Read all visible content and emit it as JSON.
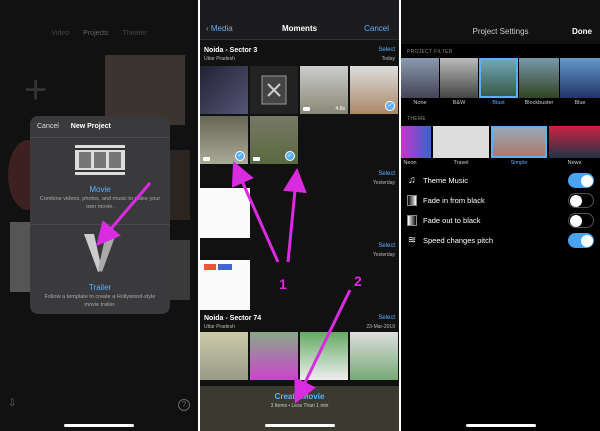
{
  "panel1": {
    "tabs": [
      "Video",
      "Projects",
      "Theater"
    ],
    "dialog": {
      "cancel": "Cancel",
      "title": "New Project",
      "movie": {
        "name": "Movie",
        "desc": "Combine videos, photos, and music to make your own movie."
      },
      "trailer": {
        "name": "Trailer",
        "desc": "Follow a template to create a Hollywood-style movie trailer."
      }
    }
  },
  "panel2": {
    "nav": {
      "back": "Media",
      "title": "Moments",
      "cancel": "Cancel"
    },
    "sections": [
      {
        "loc": "Noida - Sector 3",
        "sub": "Uttar Pradesh",
        "select": "Select",
        "date": "Today"
      },
      {
        "loc": "",
        "sub": "",
        "select": "Select",
        "date": "Yesterday"
      },
      {
        "loc": "",
        "sub": "",
        "select": "Select",
        "date": "Yesterday"
      },
      {
        "loc": "Noida - Sector 74",
        "sub": "Uttar Pradesh",
        "select": "Select",
        "date": "23-Mar-2019"
      }
    ],
    "durations": [
      "4.8s"
    ],
    "create": {
      "label": "Create Movie",
      "info": "3 Items • Less Than 1 min"
    },
    "annotations": [
      "1",
      "2"
    ]
  },
  "panel3": {
    "nav": {
      "title": "Project Settings",
      "done": "Done"
    },
    "filter_header": "PROJECT FILTER",
    "filters": [
      "None",
      "B&W",
      "Blast",
      "Blockbuster",
      "Blue"
    ],
    "selected_filter": "Blast",
    "theme_header": "THEME",
    "themes": [
      "Neon",
      "Travel",
      "Simple",
      "News"
    ],
    "selected_theme": "Simple",
    "settings": [
      {
        "label": "Theme Music",
        "on": true,
        "icon": "music-note-icon"
      },
      {
        "label": "Fade in from black",
        "on": false,
        "icon": "fade-in-icon"
      },
      {
        "label": "Fade out to black",
        "on": false,
        "icon": "fade-out-icon"
      },
      {
        "label": "Speed changes pitch",
        "on": true,
        "icon": "waveform-icon"
      }
    ]
  },
  "colors": {
    "accent": "#5ab0ff",
    "annotation": "#d92be0",
    "toggle_on": "#4aa3f0"
  }
}
